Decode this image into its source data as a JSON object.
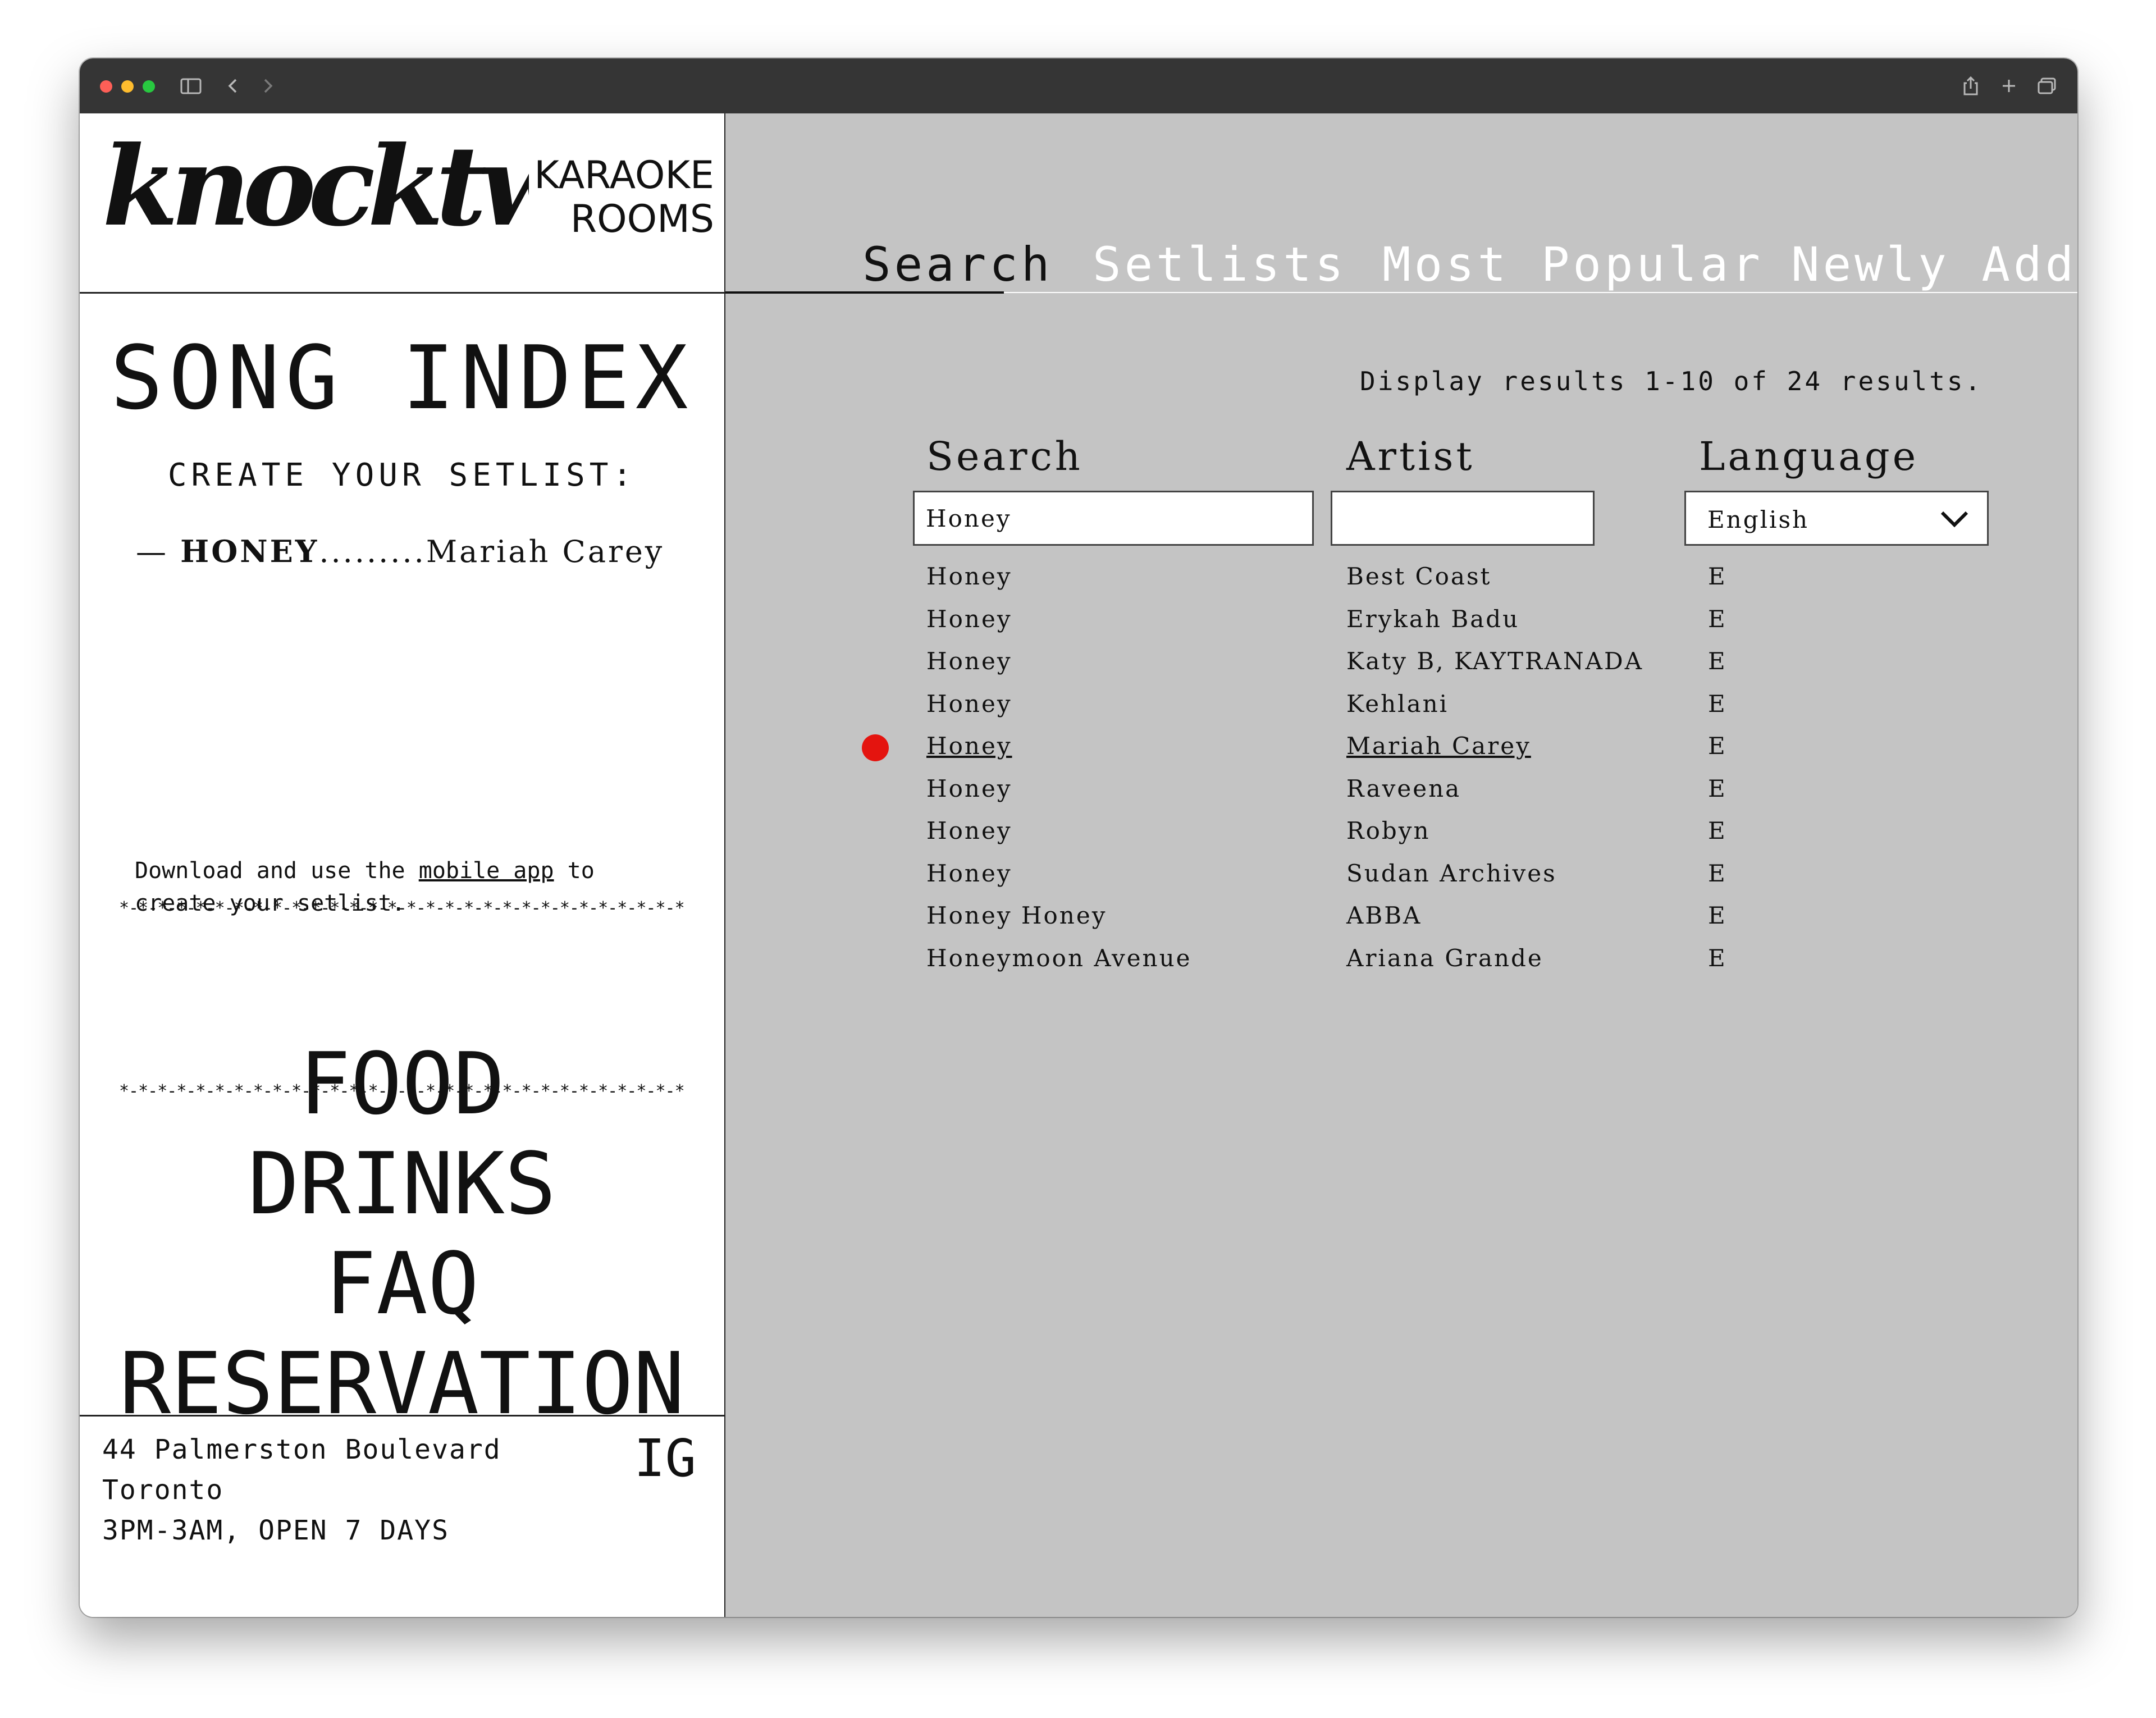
{
  "brand": {
    "logo_text": "knocktwice",
    "sub_line1": "KARAOKE",
    "sub_line2": "ROOMS"
  },
  "sidebar": {
    "title": "SONG INDEX",
    "create_label": "CREATE YOUR SETLIST:",
    "setlist": {
      "dash": "—",
      "song": "HONEY",
      "dots": ".........",
      "artist": "Mariah Carey"
    },
    "stars": "*-*-*-*-*-*-*-*-*-*-*-*-*-*-*-*-*-*-*-*-*-*-*-*-*-*-*-*-*-*-*",
    "download_prefix": "Download and use the ",
    "download_link": "mobile app",
    "download_suffix": " to create your setlist.",
    "menu": [
      "FOOD",
      "DRINKS",
      "FAQ",
      "RESERVATION"
    ],
    "address": {
      "line1": "44 Palmerston Boulevard",
      "line2": "Toronto",
      "line3": "3PM-3AM, OPEN 7 DAYS"
    },
    "ig_label": "IG"
  },
  "tabs": [
    {
      "label": "Search",
      "active": true
    },
    {
      "label": "Setlists",
      "active": false
    },
    {
      "label": "Most Popular",
      "active": false
    },
    {
      "label": "Newly Added",
      "active": false
    }
  ],
  "results_info": "Display results 1-10 of 24 results.",
  "columns": {
    "search": "Search",
    "artist": "Artist",
    "language": "Language"
  },
  "filters": {
    "search_value": "Honey",
    "artist_value": "",
    "language_value": "English"
  },
  "results": [
    {
      "title": "Honey",
      "artist": "Best Coast",
      "lang": "E",
      "selected": false
    },
    {
      "title": "Honey",
      "artist": "Erykah Badu",
      "lang": "E",
      "selected": false
    },
    {
      "title": "Honey",
      "artist": "Katy B, KAYTRANADA",
      "lang": "E",
      "selected": false
    },
    {
      "title": "Honey",
      "artist": "Kehlani",
      "lang": "E",
      "selected": false
    },
    {
      "title": "Honey",
      "artist": "Mariah Carey",
      "lang": "E",
      "selected": true
    },
    {
      "title": "Honey",
      "artist": "Raveena",
      "lang": "E",
      "selected": false
    },
    {
      "title": "Honey",
      "artist": "Robyn",
      "lang": "E",
      "selected": false
    },
    {
      "title": "Honey",
      "artist": "Sudan Archives",
      "lang": "E",
      "selected": false
    },
    {
      "title": "Honey Honey",
      "artist": "ABBA",
      "lang": "E",
      "selected": false
    },
    {
      "title": "Honeymoon Avenue",
      "artist": "Ariana Grande",
      "lang": "E",
      "selected": false
    }
  ],
  "colors": {
    "selected_dot": "#e4140f",
    "right_bg": "#c4c4c4",
    "tab_inactive": "#ffffff"
  },
  "icons": {
    "sidebar_toggle": "sidebar-icon",
    "back": "chevron-left-icon",
    "forward": "chevron-right-icon",
    "share": "share-icon",
    "new_tab": "plus-icon",
    "tabs": "tabs-icon",
    "dropdown": "chevron-down-icon",
    "selected_marker": "red-dot-icon"
  }
}
